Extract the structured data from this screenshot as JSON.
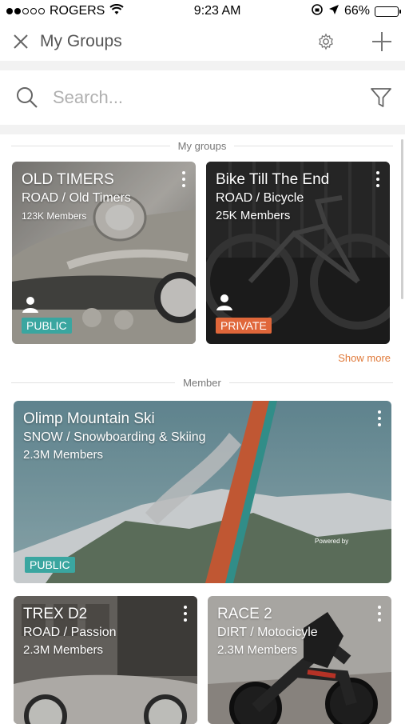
{
  "status_bar": {
    "carrier": "ROGERS",
    "time": "9:23 AM",
    "battery": "66%",
    "battery_level": 0.66
  },
  "header": {
    "title": "My Groups",
    "close_icon": "close-icon",
    "settings_icon": "gear-icon",
    "add_icon": "plus-icon"
  },
  "search": {
    "placeholder": "Search...",
    "search_icon": "search-icon",
    "filter_icon": "filter-icon"
  },
  "sections": {
    "my_groups": "My groups",
    "member": "Member",
    "show_more": "Show more"
  },
  "my_groups": [
    {
      "name": "OLD TIMERS",
      "category": "ROAD / Old Timers",
      "members": "123K Members",
      "badge": "PUBLIC",
      "badge_color": "#3aa6a0"
    },
    {
      "name": "Bike Till The End",
      "category": "ROAD / Bicycle",
      "members": "25K Members",
      "badge": "PRIVATE",
      "badge_color": "#e0673a"
    }
  ],
  "member_groups": [
    {
      "name": "Olimp Mountain Ski",
      "category": "SNOW / Snowboarding & Skiing",
      "members": "2.3M Members",
      "badge": "PUBLIC",
      "badge_color": "#3aa6a0",
      "caption": "Powered by"
    },
    {
      "name": "TREX D2",
      "category": "ROAD / Passion",
      "members": "2.3M Members"
    },
    {
      "name": "RACE 2",
      "category": "DIRT / Motocicyle",
      "members": "2.3M Members"
    }
  ]
}
